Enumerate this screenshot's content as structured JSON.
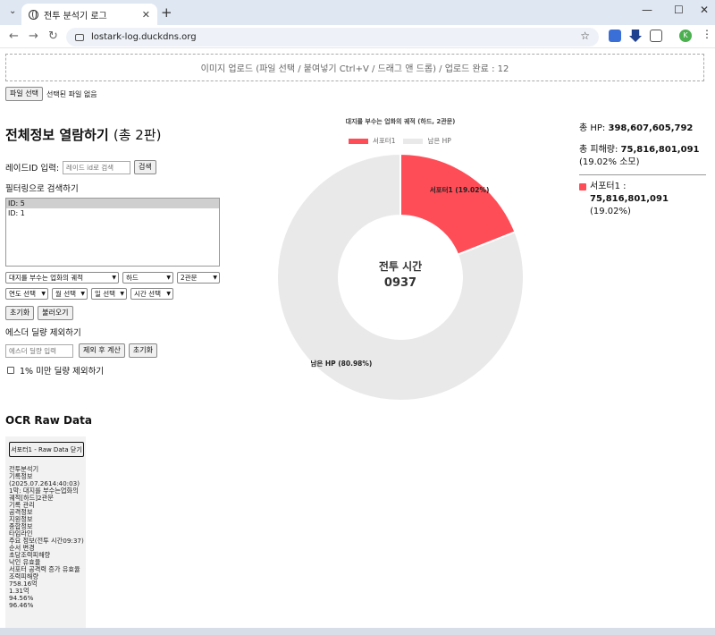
{
  "browser": {
    "tab_title": "전투 분석기 로그",
    "tab_close": "✕",
    "new_tab": "+",
    "url": "lostark-log.duckdns.org",
    "avatar_letter": "K"
  },
  "upload": {
    "text": "이미지 업로드 (파일 선택 / 붙여넣기 Ctrl+V / 드래그 앤 드롭) / 업로드 완료 : 12"
  },
  "file": {
    "button_label": "파일 선택",
    "status": "선택된 파일 없음"
  },
  "page": {
    "title": "전체정보 열람하기",
    "title_count": "(총 2판)"
  },
  "raid_search": {
    "label": "레이드ID 입력:",
    "placeholder": "레이드 id로 검색",
    "button": "검색"
  },
  "filter": {
    "heading": "필터링으로 검색하기",
    "ids": [
      "ID: 5",
      "ID: 1"
    ],
    "selected_index": 0,
    "raid_select": "대지를 부수는 업화의 궤적",
    "difficulty_select": "하드",
    "gate_select": "2관문",
    "year_select": "연도 선택",
    "month_select": "월 선택",
    "day_select": "일 선택",
    "time_select": "시간 선택",
    "reset_button": "초기화",
    "load_button": "불러오기"
  },
  "esther": {
    "heading": "에스더 딜량 제외하기",
    "placeholder": "에스더 딜량 입력",
    "apply_button": "제외 후 계산",
    "reset_button": "초기화",
    "checkbox_label": "1% 미만 딜량 제외하기"
  },
  "ocr": {
    "heading": "OCR Raw Data",
    "toggle_button": "서포터1 - Raw Data 닫기",
    "raw_text": "전투분석기\n기록정보\n(2025.07.2614:40:03)\n1막: 대지를 부수는업화의 궤적[하드]2관문\n기록 관리\n공격정보\n지원정보\n종합정보\n타임라인\n주요 정보(전투 시간09:37)\n순서 변경\n초당조력피해량\n낙인 유효율\n서포터 공격력 증가 유효율\n조력피해량\n758.16억\n1.31억\n94.56%\n96.46%"
  },
  "chart_data": {
    "type": "pie",
    "title": "대지를 부수는 업화의 궤적 (하드, 2관문)",
    "center_label": "전투 시간",
    "center_value": "0937",
    "series": [
      {
        "name": "서포터1",
        "value": 19.02,
        "label": "서포터1 (19.02%)",
        "color": "#ff4d57"
      },
      {
        "name": "남은 HP",
        "value": 80.98,
        "label": "남은 HP (80.98%)",
        "color": "#e9e9e9"
      }
    ],
    "legend_position": "top",
    "hole_ratio": 0.5
  },
  "stats": {
    "total_hp_label": "총 HP:",
    "total_hp": "398,607,605,792",
    "total_damage_label": "총 피해량:",
    "total_damage": "75,816,801,091",
    "consumed_pct": "(19.02% 소모)",
    "player_name": "서포터1 :",
    "player_damage": "75,816,801,091",
    "player_pct": "(19.02%)",
    "player_color": "#ff4d57"
  }
}
